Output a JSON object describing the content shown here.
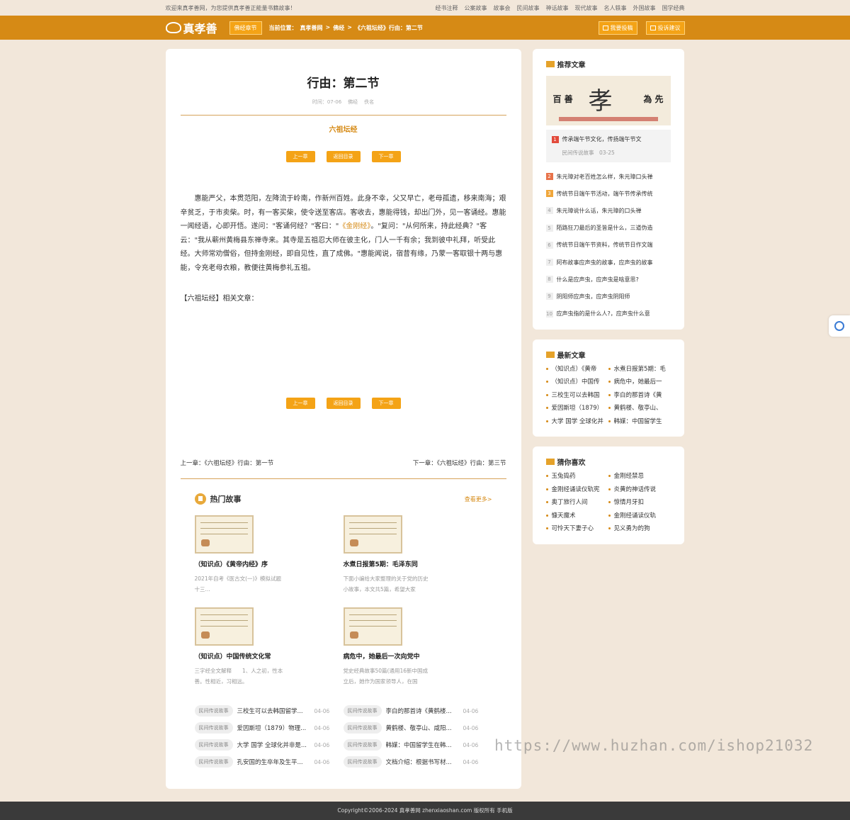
{
  "topbar": {
    "welcome": "欢迎来真孝善网，为您提供真孝善正能量书籍故事！",
    "links": [
      "经书注释",
      "公案故事",
      "故事会",
      "民间故事",
      "神话故事",
      "现代故事",
      "名人轶事",
      "外国故事",
      "国学经典"
    ]
  },
  "nav": {
    "logo": "真孝善",
    "category": "佛经章节",
    "crumb_label": "当前位置：",
    "crumb": [
      "真孝善网",
      ">",
      "佛经",
      ">",
      "《六祖坛经》行由：第二节"
    ],
    "submit_btn": "我要投稿",
    "feedback_btn": "投诉建议"
  },
  "article": {
    "title": "行由：第二节",
    "meta_time": "时间：07-06",
    "meta_cat": "佛经",
    "meta_tag": "佚名",
    "book": "六祖坛经",
    "pager": {
      "prev": "上一章",
      "toc": "返回目录",
      "next": "下一章"
    },
    "para_a": "惠能严父，本贯范阳，左降流于岭南，作新州百姓。此身不幸，父又早亡，老母孤遗，移来南海；艰辛贫乏，于市卖柴。时，有一客买柴，使令送至客店。客收去，惠能得钱，却出门外，见一客诵经。惠能一闻经语，心即开悟。遂问：\"客诵何经？\"客曰：\"",
    "para_link": "《金刚经》",
    "para_b": "。\"复问：\"从何所来，持此经典？\"客云：\"我从蕲州黄梅县东禅寺来。其寺是五祖忍大师在彼主化，门人一千有余；我到彼中礼拜，听受此经。大师常劝僧俗，但持金刚经，即自见性，直了成佛。\"惠能闻说，宿昔有缘，乃蒙一客取银十两与惠能，令充老母衣粮，教便往黄梅参礼五祖。",
    "related": "【六祖坛经】相关文章：",
    "prev_label": "上一章：",
    "prev_title": "《六祖坛经》行由：第一节",
    "next_label": "下一章：",
    "next_title": "《六祖坛经》行由：第三节"
  },
  "hot": {
    "title": "热门故事",
    "more": "查看更多>",
    "cards": [
      {
        "title": "（知识点）《黄帝内经》序",
        "desc": "2021年自考《医古文(一)》模拟试题十三..."
      },
      {
        "title": "水煮日报第5期：毛泽东同",
        "desc": "下面小编给大家整理的关于党的历史小故事，本文共5篇，希望大家"
      },
      {
        "title": "（知识点）中国传统文化常",
        "desc": "三字经全文解释　　1、人之初，性本善。性相近，习相远。"
      },
      {
        "title": "病危中，她最后一次向党中",
        "desc": "党史经典故事50篇(通用16新中国成立后，她作为国家领导人，在国"
      }
    ],
    "list": [
      {
        "tag": "民间传说故事",
        "title": "三校生可以去韩国留学...",
        "date": "04-06"
      },
      {
        "tag": "民间传说故事",
        "title": "李白的那首诗《黄鹤楼...",
        "date": "04-06"
      },
      {
        "tag": "民间传说故事",
        "title": "爱因斯坦（1879）物理...",
        "date": "04-06"
      },
      {
        "tag": "民间传说故事",
        "title": "黄鹤楼、敬亭山、咸阳...",
        "date": "04-06"
      },
      {
        "tag": "民间传说故事",
        "title": "大学 国学 全球化并非是...",
        "date": "04-06"
      },
      {
        "tag": "民间传说故事",
        "title": "韩媒：中国留学生在韩...",
        "date": "04-06"
      },
      {
        "tag": "民间传说故事",
        "title": "孔安国的生卒年及生平...",
        "date": "04-06"
      },
      {
        "tag": "民间传说故事",
        "title": "文档介绍：根据书写材...",
        "date": "04-06"
      }
    ]
  },
  "sidebar": {
    "recommend_title": "推荐文章",
    "banner_left": "百 善",
    "banner_big": "孝",
    "banner_right": "為 先",
    "first": {
      "num": "1",
      "title": "传承端午节文化，传扬端午节文",
      "meta": "民间传说故事　03-25"
    },
    "items": [
      {
        "num": "2",
        "title": "朱元璋对老百姓怎么样，朱元璋口头禅"
      },
      {
        "num": "3",
        "title": "传统节日端午节活动，端午节传承传统"
      },
      {
        "num": "4",
        "title": "朱元璋说什么话，朱元璋的口头禅"
      },
      {
        "num": "5",
        "title": "陌路狂刀最后的圣皆是什么，三道伪造"
      },
      {
        "num": "6",
        "title": "传统节日端午节资料，传统节日作文端"
      },
      {
        "num": "7",
        "title": "阿布故事应声虫的故事，应声虫的故事"
      },
      {
        "num": "8",
        "title": "什么是应声虫，应声虫是啥意思?"
      },
      {
        "num": "9",
        "title": "阴阳师应声虫，应声虫阴阳师"
      },
      {
        "num": "10",
        "title": "应声虫指的是什么人?，应声虫什么意"
      }
    ],
    "latest_title": "最新文章",
    "latest": [
      "（知识点）《黄帝",
      "水煮日报第5期：毛",
      "（知识点）中国传",
      "病危中，她最后一",
      "三校生可以去韩国",
      "李白的那首诗《黄",
      "爱因斯坦（1879）",
      "黄鹤楼、敬亭山、",
      "大学 国学 全球化并",
      "韩媒：中国留学生"
    ],
    "guess_title": "猜你喜欢",
    "guess": [
      "玉兔捣药",
      "金刚经禁忌",
      "金刚经诵读仪轨宪",
      "炎黄的神话传说",
      "奥丁旅行人间",
      "惊情月牙扣",
      "慷天魔术",
      "金刚经诵读仪轨",
      "可怜天下妻子心",
      "见义勇为的狗"
    ]
  },
  "watermark": "https://www.huzhan.com/ishop21032",
  "footer": "Copyright©2006-2024 真孝善网 zhenxiaoshan.com 版权所有 手机版"
}
